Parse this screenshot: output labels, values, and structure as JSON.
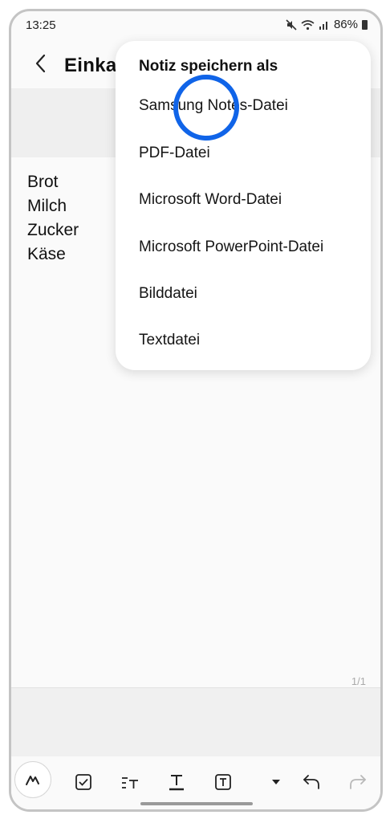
{
  "status": {
    "time": "13:25",
    "battery": "86%",
    "icons": [
      "mute-icon",
      "wifi-icon",
      "signal-icon",
      "battery-icon"
    ]
  },
  "appbar": {
    "title": "Einkau"
  },
  "note": {
    "lines": [
      "Brot",
      "Milch",
      "Zucker",
      "Käse"
    ],
    "page": "1/1"
  },
  "popup": {
    "title": "Notiz speichern als",
    "items": [
      "Samsung Notes-Datei",
      "PDF-Datei",
      "Microsoft Word-Datei",
      "Microsoft PowerPoint-Datei",
      "Bilddatei",
      "Textdatei"
    ]
  },
  "colors": {
    "highlight_ring": "#1064e8"
  }
}
